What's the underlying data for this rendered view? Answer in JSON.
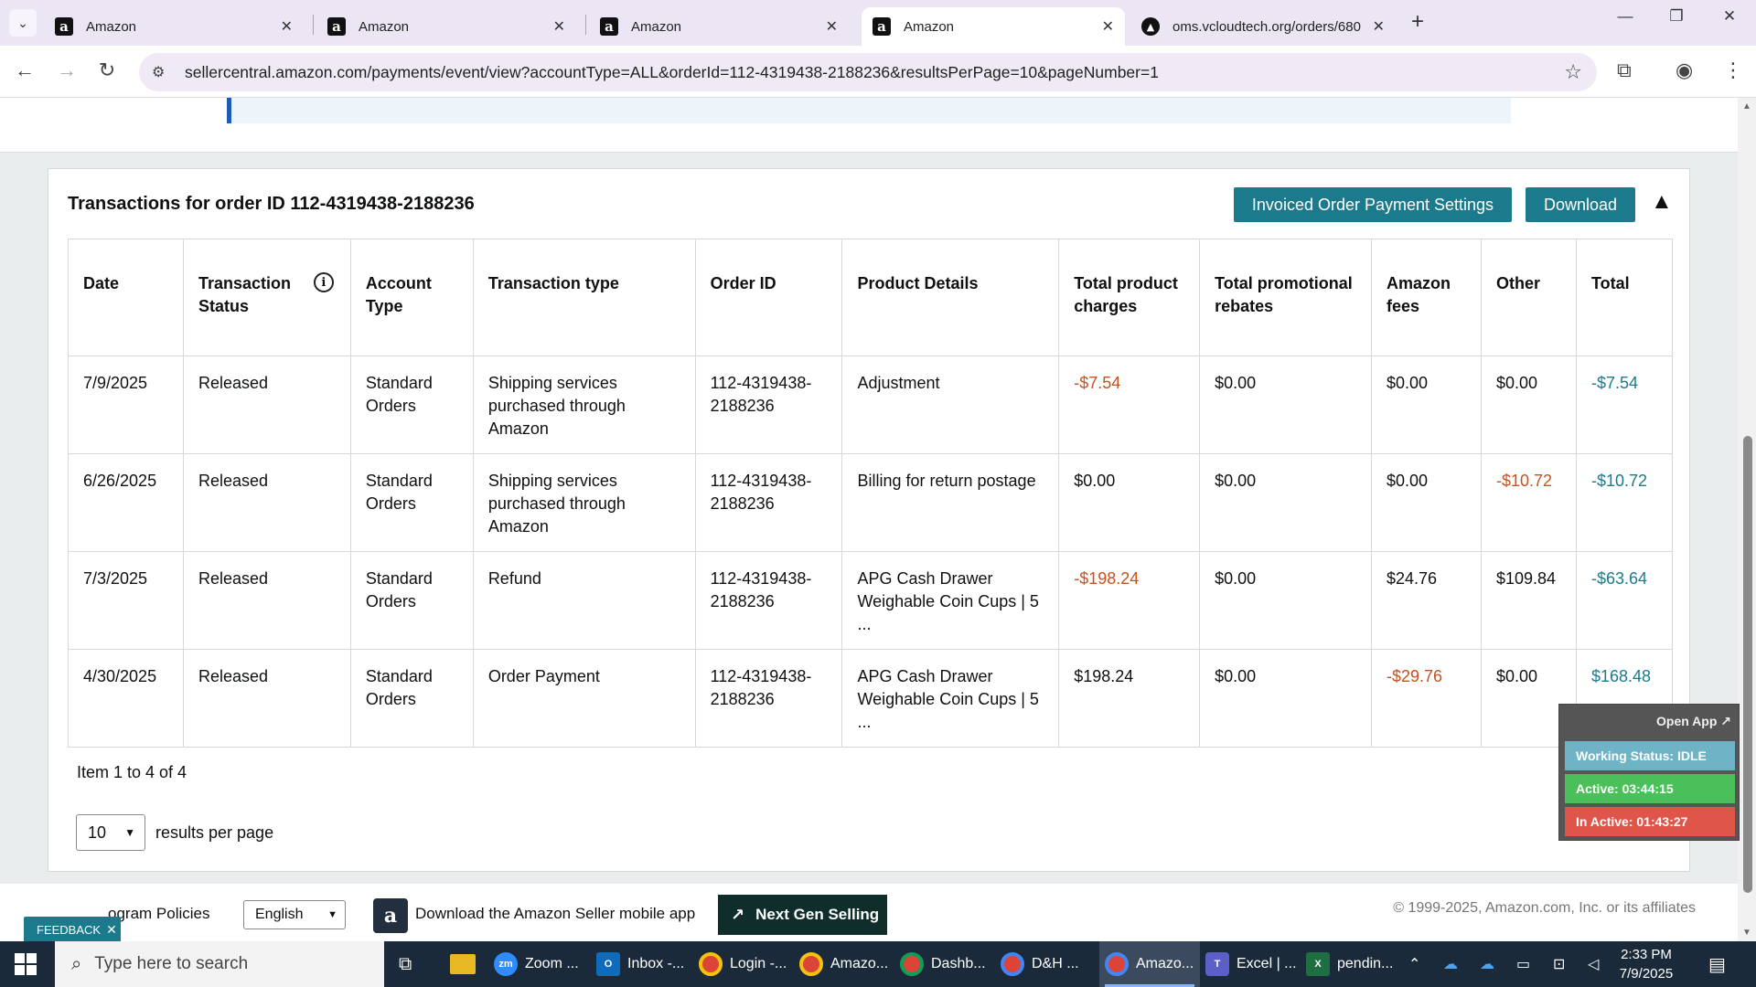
{
  "browser": {
    "tabs": [
      {
        "title": "Amazon",
        "close": "✕",
        "active": false
      },
      {
        "title": "Amazon",
        "close": "✕",
        "active": false
      },
      {
        "title": "Amazon",
        "close": "✕",
        "active": false
      },
      {
        "title": "Amazon",
        "close": "✕",
        "active": true
      },
      {
        "title": "oms.vcloudtech.org/orders/680",
        "close": "✕",
        "active": false
      }
    ],
    "url": "sellercentral.amazon.com/payments/event/view?accountType=ALL&orderId=112-4319438-2188236&resultsPerPage=10&pageNumber=1"
  },
  "card": {
    "title": "Transactions for order ID 112-4319438-2188236",
    "settings_button": "Invoiced Order Payment Settings",
    "download_button": "Download"
  },
  "table": {
    "headers": [
      "Date",
      "Transaction Status",
      "Account Type",
      "Transaction type",
      "Order ID",
      "Product Details",
      "Total product charges",
      "Total promotional rebates",
      "Amazon fees",
      "Other",
      "Total"
    ],
    "rows": [
      {
        "date": "7/9/2025",
        "status": "Released",
        "account": "Standard Orders",
        "type": "Shipping services purchased through Amazon",
        "order_id": "112-4319438-2188236",
        "product": "Adjustment",
        "charges": "-$7.54",
        "rebates": "$0.00",
        "fees": "$0.00",
        "other": "$0.00",
        "total": "-$7.54"
      },
      {
        "date": "6/26/2025",
        "status": "Released",
        "account": "Standard Orders",
        "type": "Shipping services purchased through Amazon",
        "order_id": "112-4319438-2188236",
        "product": "Billing for return postage",
        "charges": "$0.00",
        "rebates": "$0.00",
        "fees": "$0.00",
        "other": "-$10.72",
        "total": "-$10.72"
      },
      {
        "date": "7/3/2025",
        "status": "Released",
        "account": "Standard Orders",
        "type": "Refund",
        "order_id": "112-4319438-2188236",
        "product": "APG Cash Drawer Weighable Coin Cups | 5 ...",
        "charges": "-$198.24",
        "rebates": "$0.00",
        "fees": "$24.76",
        "other": "$109.84",
        "total": "-$63.64"
      },
      {
        "date": "4/30/2025",
        "status": "Released",
        "account": "Standard Orders",
        "type": "Order Payment",
        "order_id": "112-4319438-2188236",
        "product": "APG Cash Drawer Weighable Coin Cups | 5 ...",
        "charges": "$198.24",
        "rebates": "$0.00",
        "fees": "-$29.76",
        "other": "$0.00",
        "total": "$168.48"
      }
    ]
  },
  "pagination": {
    "item_count": "Item 1 to 4 of 4",
    "per_page_value": "10",
    "per_page_label": "results per page"
  },
  "footer": {
    "policies": "ogram Policies",
    "language": "English",
    "mobile_app": "Download the Amazon Seller mobile app",
    "next_gen": "Next Gen Selling",
    "copyright": "© 1999-2025, Amazon.com, Inc. or its affiliates",
    "feedback": "FEEDBACK",
    "feedback_close": "✕"
  },
  "widget": {
    "open_app": "Open App ↗",
    "working_status": "Working Status: IDLE",
    "active": "Active: 03:44:15",
    "inactive": "In Active: 01:43:27",
    "colors": {
      "status": "#6fb3c6",
      "active": "#4bbf5a",
      "inactive": "#e0554a"
    }
  },
  "taskbar": {
    "search_placeholder": "Type here to search",
    "items": [
      "Zoom ...",
      "Inbox -...",
      "Login -...",
      "Amazo...",
      "Dashb...",
      "D&H ...",
      "Amazo...",
      "Excel | ...",
      "pendin..."
    ],
    "time": "2:33 PM",
    "date": "7/9/2025"
  },
  "colors": {
    "accent": "#1b7a8c",
    "negative": "#c7511f",
    "info_border": "#1e5bb8"
  }
}
